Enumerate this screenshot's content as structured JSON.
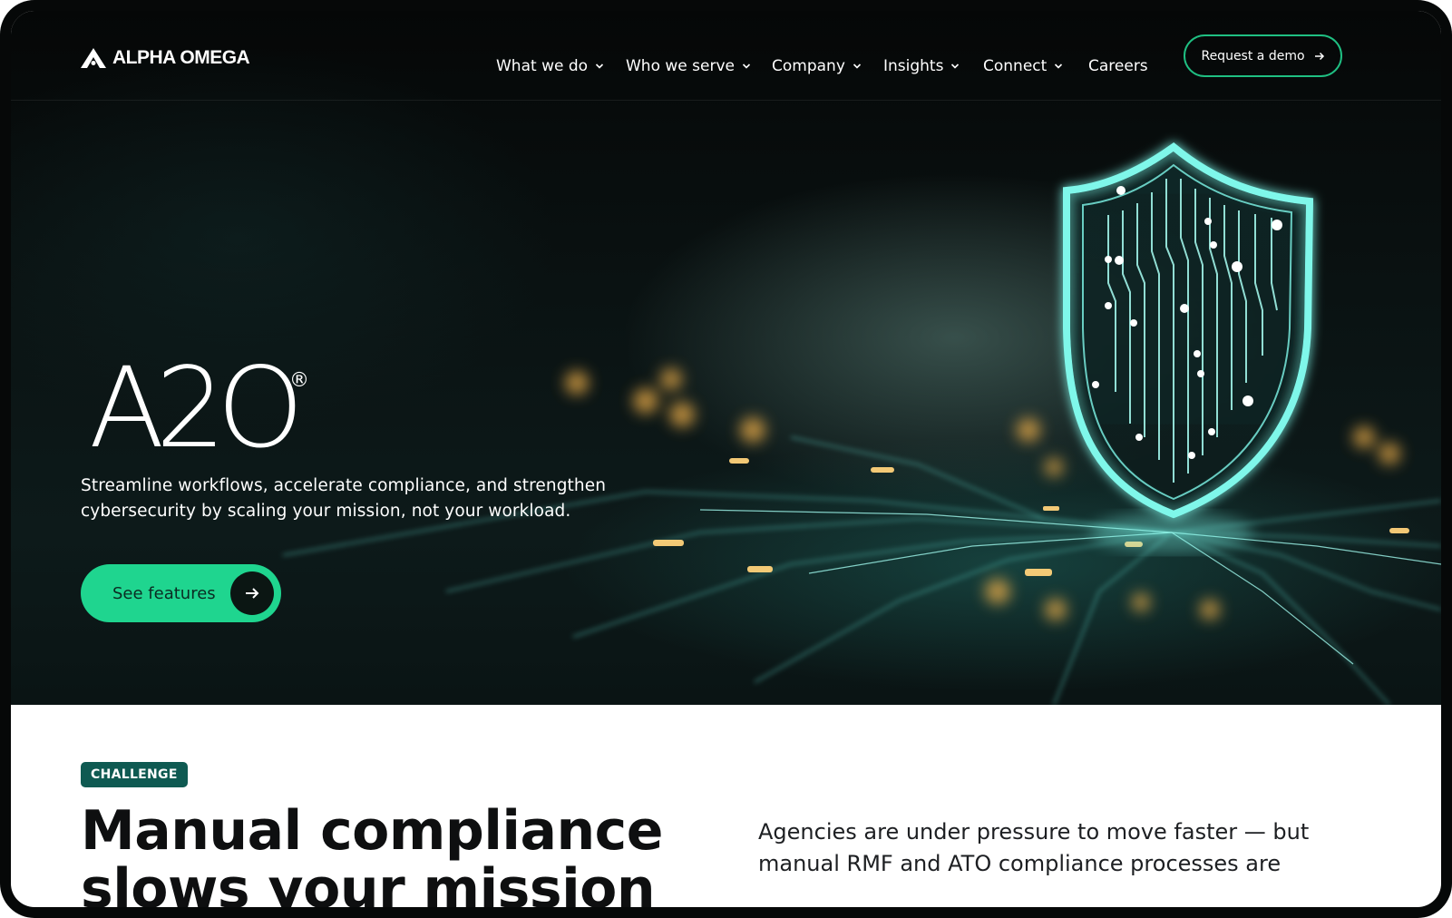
{
  "brand": {
    "logo_text": "ALPHA OMEGA"
  },
  "nav": {
    "items": [
      {
        "label": "What we do",
        "has_dropdown": true
      },
      {
        "label": "Who we serve",
        "has_dropdown": true
      },
      {
        "label": "Company",
        "has_dropdown": true
      },
      {
        "label": "Insights",
        "has_dropdown": true
      },
      {
        "label": "Connect",
        "has_dropdown": true
      },
      {
        "label": "Careers",
        "has_dropdown": false
      }
    ],
    "cta_label": "Request a demo"
  },
  "hero": {
    "product_mark": "A2O",
    "registered_symbol": "®",
    "tagline_line1": "Streamline workflows, accelerate compliance, and strengthen",
    "tagline_line2": "cybersecurity by scaling your mission, not your workload.",
    "cta_label": "See features",
    "illustration": "shield-circuit-icon"
  },
  "challenge": {
    "badge": "CHALLENGE",
    "headline_line1": "Manual compliance",
    "headline_line2": "slows your mission",
    "body_line1": "Agencies are under pressure to move faster — but",
    "body_line2": "manual RMF and ATO compliance processes are"
  },
  "colors": {
    "accent_green": "#1fd58f",
    "badge_teal": "#0f5a52",
    "hero_bg": "#050707",
    "shield_glow": "#6ff5e6"
  }
}
